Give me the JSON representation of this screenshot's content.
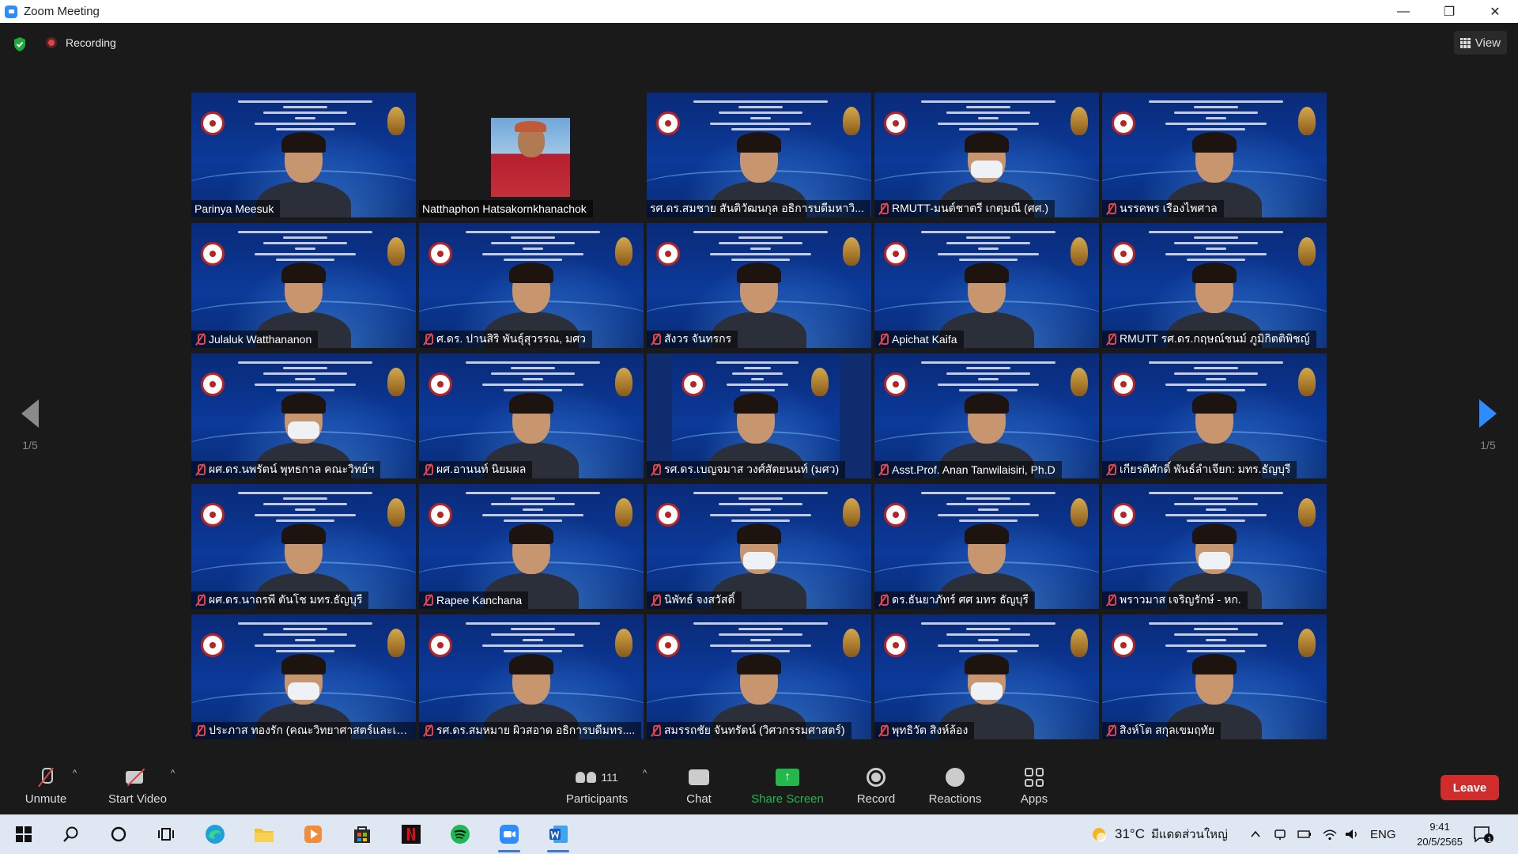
{
  "window": {
    "title": "Zoom Meeting",
    "minimize": "—",
    "restore": "❐",
    "close": "✕"
  },
  "meeting": {
    "recording_label": "Recording",
    "view_label": "View",
    "page_indicator_left": "1/5",
    "page_indicator_right": "1/5"
  },
  "participants": [
    {
      "name": "Parinya Meesuk",
      "muted": false,
      "active": true,
      "video": "banner",
      "masked": false
    },
    {
      "name": "Natthaphon Hatsakornkhanachok",
      "muted": false,
      "active": false,
      "video": "photo",
      "masked": false
    },
    {
      "name": "รศ.ดร.สมชาย สันติวัฒนกุล อธิการบดีมหาวิ...",
      "muted": false,
      "active": false,
      "video": "banner",
      "masked": false
    },
    {
      "name": "RMUTT-มนต์ชาตรี เกตุมณี (ศศ.)",
      "muted": true,
      "active": false,
      "video": "banner",
      "masked": true
    },
    {
      "name": "นรรคพร เรืองไพศาล",
      "muted": true,
      "active": false,
      "video": "banner",
      "masked": false
    },
    {
      "name": "Julaluk Watthananon",
      "muted": true,
      "active": false,
      "video": "banner",
      "masked": false
    },
    {
      "name": "ศ.ดร. ปานสิริ พันธุ์สุวรรณ, มศว",
      "muted": true,
      "active": false,
      "video": "banner",
      "masked": false
    },
    {
      "name": "สังวร จันทรกร",
      "muted": true,
      "active": false,
      "video": "banner",
      "masked": false
    },
    {
      "name": "Apichat Kaifa",
      "muted": true,
      "active": false,
      "video": "banner",
      "masked": false
    },
    {
      "name": "RMUTT รศ.ดร.กฤษณ์ชนม์ ภูมิกิตติพิชญ์",
      "muted": true,
      "active": false,
      "video": "banner",
      "masked": false
    },
    {
      "name": "ผศ.ดร.นพรัตน์ พุทธกาล คณะวิทย์ฯ",
      "muted": true,
      "active": false,
      "video": "banner",
      "masked": true
    },
    {
      "name": "ผศ.อานนท์ นิยมผล",
      "muted": true,
      "active": false,
      "video": "banner",
      "masked": false
    },
    {
      "name": "รศ.ดร.เบญจมาส วงศ์สัตยนนท์ (มศว)",
      "muted": true,
      "active": false,
      "video": "centered",
      "masked": false
    },
    {
      "name": "Asst.Prof. Anan Tanwilaisiri, Ph.D",
      "muted": true,
      "active": false,
      "video": "banner",
      "masked": false
    },
    {
      "name": "เกียรติศักดิ์ พันธ์ลำเจียก: มทร.ธัญบุรี",
      "muted": true,
      "active": false,
      "video": "banner",
      "masked": false
    },
    {
      "name": "ผศ.ดร.นาถรพี ตันโช มทร.ธัญบุรี",
      "muted": true,
      "active": false,
      "video": "banner",
      "masked": false
    },
    {
      "name": "Rapee Kanchana",
      "muted": true,
      "active": false,
      "video": "banner",
      "masked": false
    },
    {
      "name": "นิพัทธ์ จงสวัสดิ์",
      "muted": true,
      "active": false,
      "video": "banner",
      "masked": true
    },
    {
      "name": "ดร.ธันยาภัทร์ ศศ มทร ธัญบุรี",
      "muted": true,
      "active": false,
      "video": "banner",
      "masked": false
    },
    {
      "name": "พราวมาส เจริญรักษ์ - หก.",
      "muted": true,
      "active": false,
      "video": "banner",
      "masked": true
    },
    {
      "name": "ประภาส ทองรัก (คณะวิทยาศาสตร์และเท...",
      "muted": true,
      "active": false,
      "video": "banner",
      "masked": true
    },
    {
      "name": "รศ.ดร.สมหมาย ผิวสอาด อธิการบดีมทร....",
      "muted": true,
      "active": false,
      "video": "banner",
      "masked": false
    },
    {
      "name": "สมรรถชัย จันทรัตน์ (วิศวกรรมศาสตร์)",
      "muted": true,
      "active": false,
      "video": "banner",
      "masked": false
    },
    {
      "name": "พุทธิวัต สิงห์ล้อง",
      "muted": true,
      "active": false,
      "video": "banner",
      "masked": true
    },
    {
      "name": "สิงห์โต สกุลเขมฤทัย",
      "muted": true,
      "active": false,
      "video": "banner",
      "masked": false
    }
  ],
  "toolbar": {
    "unmute": "Unmute",
    "start_video": "Start Video",
    "participants": "Participants",
    "participants_count": "111",
    "chat": "Chat",
    "share_screen": "Share Screen",
    "record": "Record",
    "reactions": "Reactions",
    "apps": "Apps",
    "leave": "Leave",
    "caret": "^"
  },
  "taskbar": {
    "weather_temp": "31°C",
    "weather_desc": "มีแดดส่วนใหญ่",
    "language": "ENG",
    "time": "9:41",
    "date": "20/5/2565",
    "notification_count": "1"
  },
  "colors": {
    "share_green": "#22b84a",
    "leave_red": "#d02c2c",
    "active_speaker": "#c8e34a",
    "next_arrow": "#2d8cff"
  }
}
